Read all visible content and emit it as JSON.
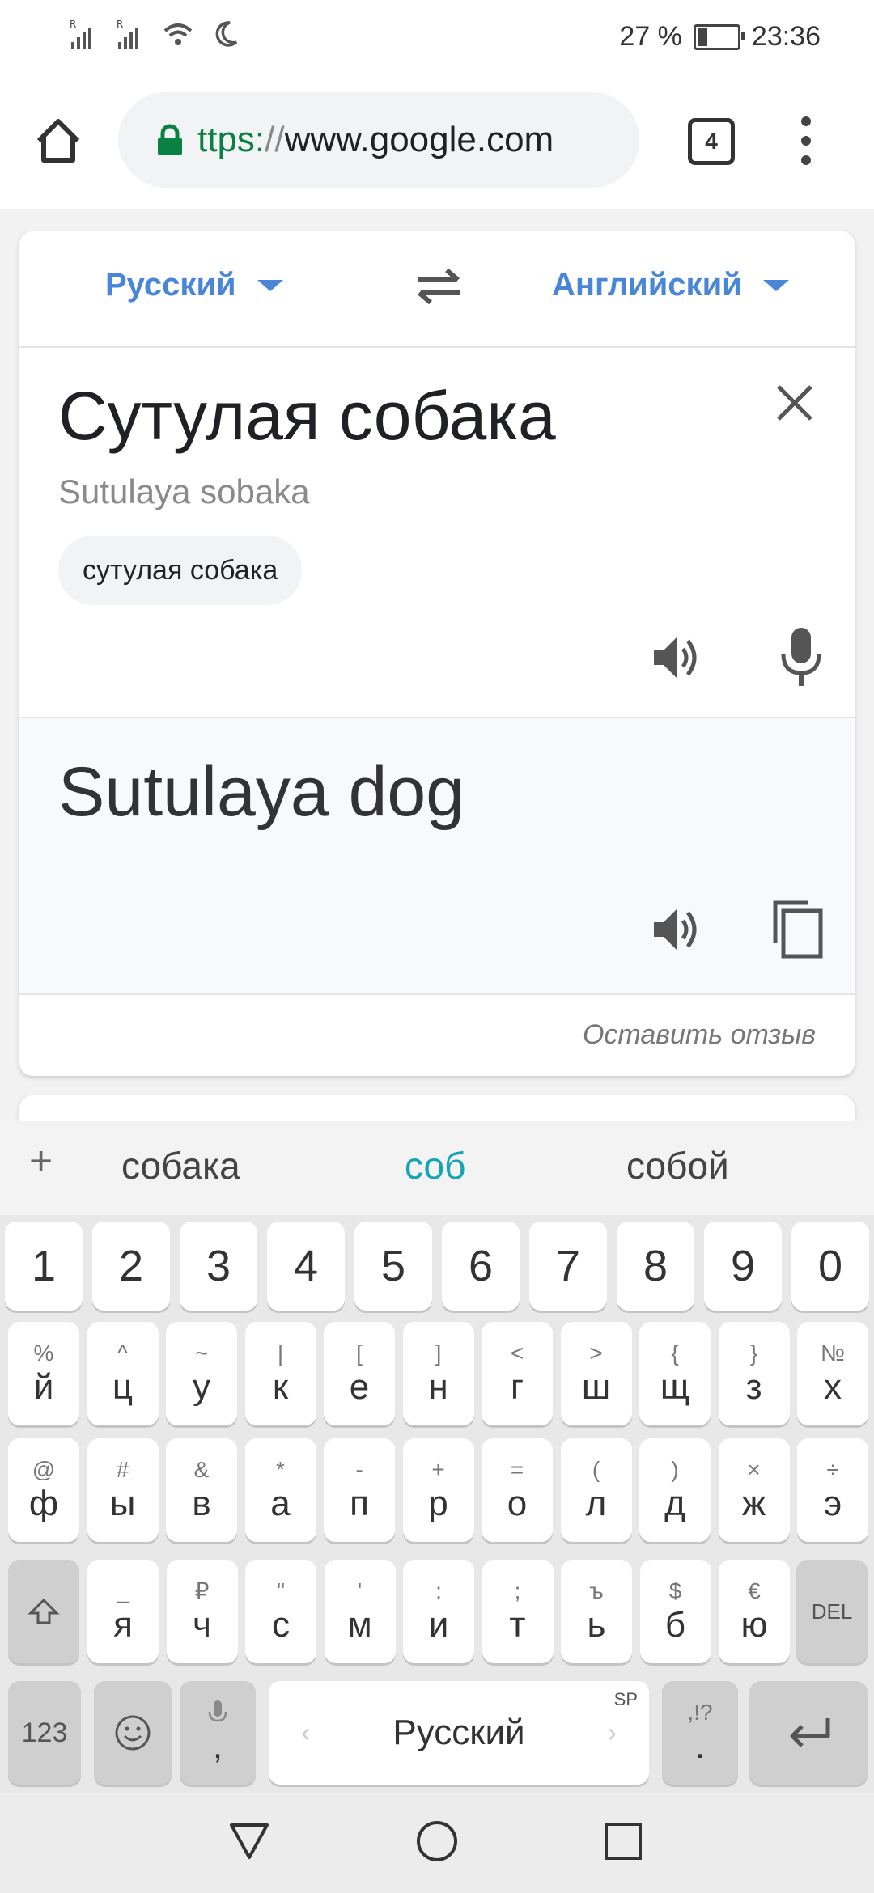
{
  "status_bar": {
    "battery_percent": "27 %",
    "battery_level": 0.27,
    "time": "23:36",
    "icons": [
      "signal-r-icon",
      "signal-r-icon",
      "wifi-icon",
      "moon-icon",
      "battery-icon"
    ]
  },
  "browser": {
    "url_scheme": "ttps:",
    "url_sep": "//",
    "url_host": "www.google.com",
    "tab_count": "4"
  },
  "translator": {
    "source_lang": "Русский",
    "target_lang": "Английский",
    "source_text": "Сутулая собака",
    "transliteration": "Sutulaya sobaka",
    "suggestion_chip": "сутулая собака",
    "translation": "Sutulaya dog",
    "feedback": "Оставить отзыв"
  },
  "keyboard": {
    "suggestions": [
      "собака",
      "соб",
      "собой"
    ],
    "number_row": [
      "1",
      "2",
      "3",
      "4",
      "5",
      "6",
      "7",
      "8",
      "9",
      "0"
    ],
    "row1": [
      {
        "sub": "%",
        "main": "й"
      },
      {
        "sub": "^",
        "main": "ц"
      },
      {
        "sub": "~",
        "main": "у"
      },
      {
        "sub": "|",
        "main": "к"
      },
      {
        "sub": "[",
        "main": "е"
      },
      {
        "sub": "]",
        "main": "н"
      },
      {
        "sub": "<",
        "main": "г"
      },
      {
        "sub": ">",
        "main": "ш"
      },
      {
        "sub": "{",
        "main": "щ"
      },
      {
        "sub": "}",
        "main": "з"
      },
      {
        "sub": "№",
        "main": "х"
      }
    ],
    "row2": [
      {
        "sub": "@",
        "main": "ф"
      },
      {
        "sub": "#",
        "main": "ы"
      },
      {
        "sub": "&",
        "main": "в"
      },
      {
        "sub": "*",
        "main": "а"
      },
      {
        "sub": "-",
        "main": "п"
      },
      {
        "sub": "+",
        "main": "р"
      },
      {
        "sub": "=",
        "main": "о"
      },
      {
        "sub": "(",
        "main": "л"
      },
      {
        "sub": ")",
        "main": "д"
      },
      {
        "sub": "×",
        "main": "ж"
      },
      {
        "sub": "÷",
        "main": "э"
      }
    ],
    "row3": [
      {
        "sub": "_",
        "main": "я"
      },
      {
        "sub": "₽",
        "main": "ч"
      },
      {
        "sub": "\"",
        "main": "с"
      },
      {
        "sub": "'",
        "main": "м"
      },
      {
        "sub": ":",
        "main": "и"
      },
      {
        "sub": ";",
        "main": "т"
      },
      {
        "sub": "ъ",
        "main": "ь"
      },
      {
        "sub": "$",
        "main": "б"
      },
      {
        "sub": "€",
        "main": "ю"
      }
    ],
    "del_label": "DEL",
    "numbers_label": "123",
    "comma_label": ",",
    "space_label": "Русский",
    "space_corner": "SP",
    "period_sub": ",!?",
    "period_label": "."
  }
}
